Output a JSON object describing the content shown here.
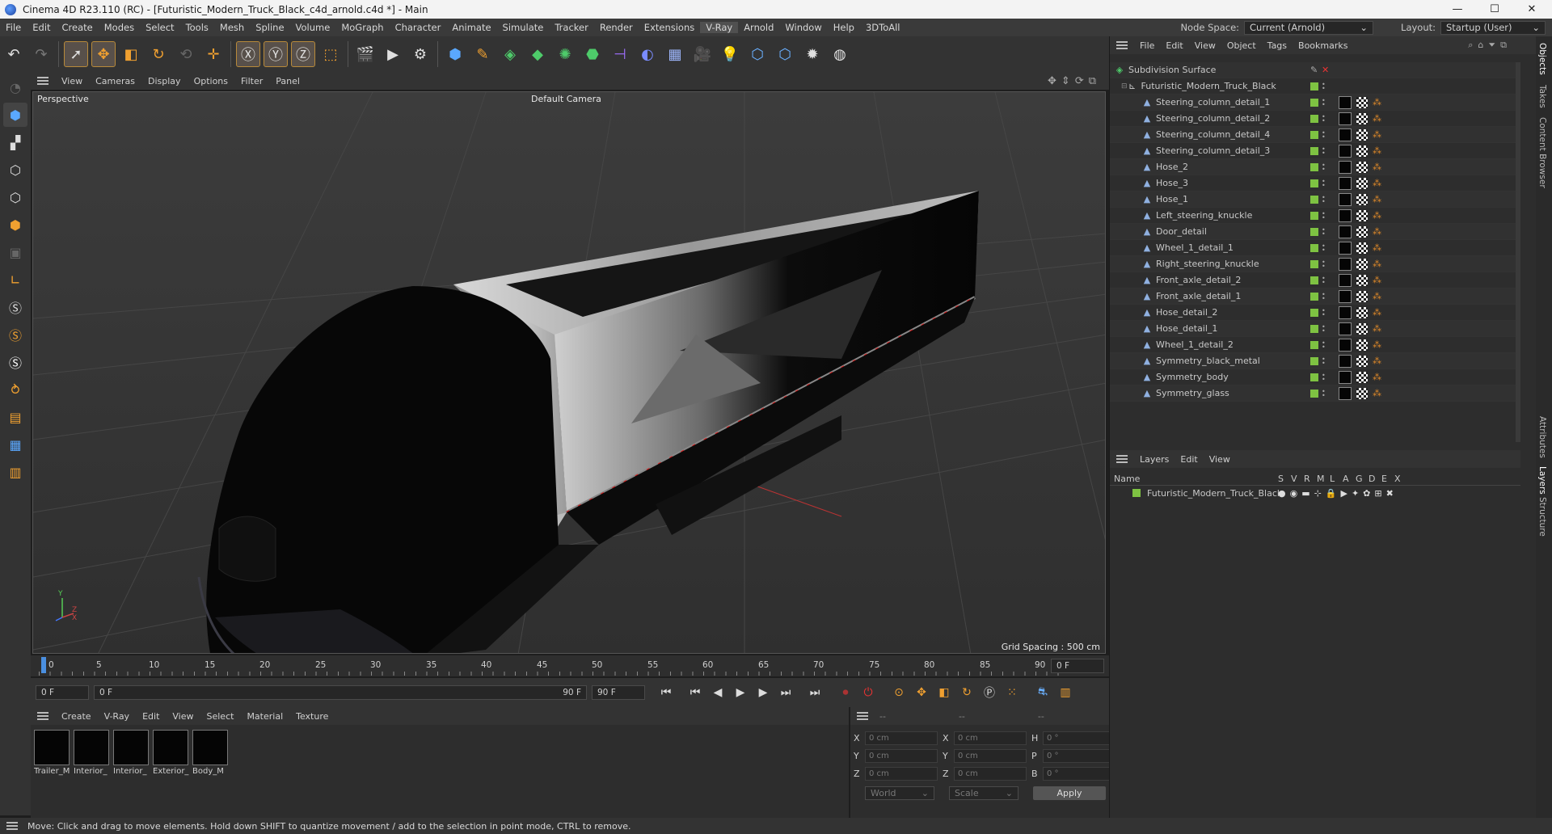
{
  "window": {
    "title": "Cinema 4D R23.110 (RC) - [Futuristic_Modern_Truck_Black_c4d_arnold.c4d *] - Main",
    "min": "—",
    "max": "☐",
    "close": "✕"
  },
  "menu": {
    "items": [
      "File",
      "Edit",
      "Create",
      "Modes",
      "Select",
      "Tools",
      "Mesh",
      "Spline",
      "Volume",
      "MoGraph",
      "Character",
      "Animate",
      "Simulate",
      "Tracker",
      "Render",
      "Extensions",
      "V-Ray",
      "Arnold",
      "Window",
      "Help",
      "3DToAll"
    ],
    "node_space_label": "Node Space:",
    "node_space_value": "Current (Arnold)",
    "layout_label": "Layout:",
    "layout_value": "Startup (User)"
  },
  "viewport": {
    "menu": [
      "View",
      "Cameras",
      "Display",
      "Options",
      "Filter",
      "Panel"
    ],
    "projection": "Perspective",
    "camera": "Default Camera",
    "grid_spacing": "Grid Spacing : 500 cm",
    "axis_y": "Y",
    "axis_z": "Z",
    "axis_x": "X"
  },
  "timeline": {
    "ticks": [
      "0",
      "5",
      "10",
      "15",
      "20",
      "25",
      "30",
      "35",
      "40",
      "45",
      "50",
      "55",
      "60",
      "65",
      "70",
      "75",
      "80",
      "85",
      "90"
    ],
    "current_frame_right": "0 F",
    "start": "0 F",
    "range_start": "0 F",
    "range_end": "90 F",
    "end": "90 F"
  },
  "materials": {
    "menu": [
      "Create",
      "V-Ray",
      "Edit",
      "View",
      "Select",
      "Material",
      "Texture"
    ],
    "items": [
      "Trailer_M",
      "Interior_",
      "Interior_",
      "Exterior_",
      "Body_M"
    ]
  },
  "coords": {
    "headers": [
      "--",
      "--",
      "--"
    ],
    "rows": [
      {
        "l1": "X",
        "v1": "0 cm",
        "l2": "X",
        "v2": "0 cm",
        "l3": "H",
        "v3": "0 °"
      },
      {
        "l1": "Y",
        "v1": "0 cm",
        "l2": "Y",
        "v2": "0 cm",
        "l3": "P",
        "v3": "0 °"
      },
      {
        "l1": "Z",
        "v1": "0 cm",
        "l2": "Z",
        "v2": "0 cm",
        "l3": "B",
        "v3": "0 °"
      }
    ],
    "world": "World",
    "scale": "Scale",
    "apply": "Apply"
  },
  "objects": {
    "menu": [
      "File",
      "Edit",
      "View",
      "Object",
      "Tags",
      "Bookmarks"
    ],
    "root": "Subdivision Surface",
    "group": "Futuristic_Modern_Truck_Black",
    "children": [
      "Steering_column_detail_1",
      "Steering_column_detail_2",
      "Steering_column_detail_4",
      "Steering_column_detail_3",
      "Hose_2",
      "Hose_3",
      "Hose_1",
      "Left_steering_knuckle",
      "Door_detail",
      "Wheel_1_detail_1",
      "Right_steering_knuckle",
      "Front_axle_detail_2",
      "Front_axle_detail_1",
      "Hose_detail_2",
      "Hose_detail_1",
      "Wheel_1_detail_2",
      "Symmetry_black_metal",
      "Symmetry_body",
      "Symmetry_glass"
    ]
  },
  "layers": {
    "menu": [
      "Layers",
      "Edit",
      "View"
    ],
    "name_col": "Name",
    "cols": [
      "S",
      "V",
      "R",
      "M",
      "L",
      "A",
      "G",
      "D",
      "E",
      "X"
    ],
    "items": [
      "Futuristic_Modern_Truck_Black"
    ]
  },
  "side_tabs": [
    "Objects",
    "Takes",
    "Content Browser",
    "Attributes",
    "Layers",
    "Structure"
  ],
  "status": "Move: Click and drag to move elements. Hold down SHIFT to quantize movement / add to the selection in point mode, CTRL to remove.",
  "colors": {
    "accent": "#7ec242",
    "tag_orange": "#e08a2a"
  }
}
